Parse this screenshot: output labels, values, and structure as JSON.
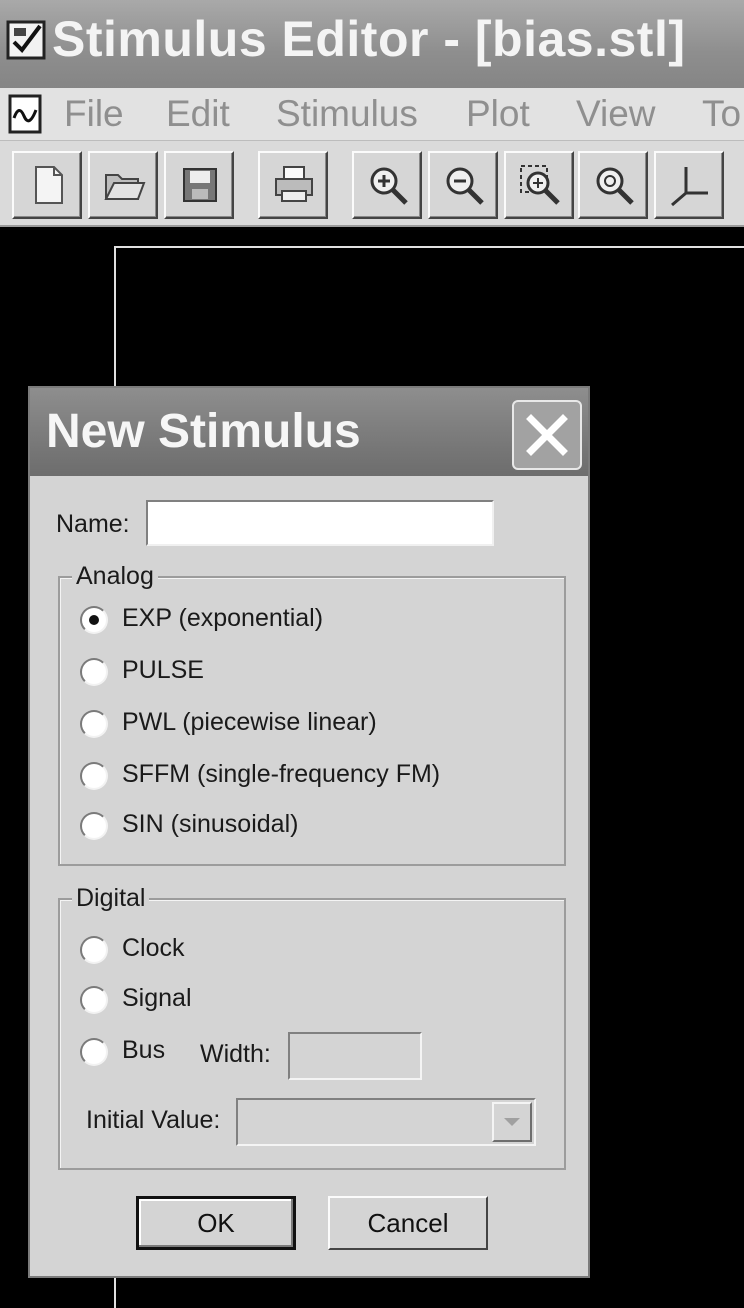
{
  "window": {
    "title": "Stimulus Editor - [bias.stl]"
  },
  "menu": {
    "items": [
      "File",
      "Edit",
      "Stimulus",
      "Plot",
      "View",
      "To"
    ]
  },
  "toolbar": {
    "buttons": [
      "new-file",
      "open-folder",
      "save-disk",
      "print",
      "zoom-in",
      "zoom-out",
      "zoom-area",
      "zoom-fit",
      "axis"
    ]
  },
  "dialog": {
    "title": "New Stimulus",
    "name_label": "Name:",
    "name_value": "",
    "analog": {
      "legend": "Analog",
      "options": [
        {
          "label": "EXP (exponential)",
          "checked": true
        },
        {
          "label": "PULSE",
          "checked": false
        },
        {
          "label": "PWL (piecewise linear)",
          "checked": false
        },
        {
          "label": "SFFM (single-frequency FM)",
          "checked": false
        },
        {
          "label": "SIN (sinusoidal)",
          "checked": false
        }
      ]
    },
    "digital": {
      "legend": "Digital",
      "options": [
        {
          "label": "Clock",
          "checked": false
        },
        {
          "label": "Signal",
          "checked": false
        },
        {
          "label": "Bus",
          "checked": false
        }
      ],
      "width_label": "Width:",
      "width_value": "",
      "initial_value_label": "Initial Value:",
      "initial_value": ""
    },
    "ok_label": "OK",
    "cancel_label": "Cancel"
  }
}
